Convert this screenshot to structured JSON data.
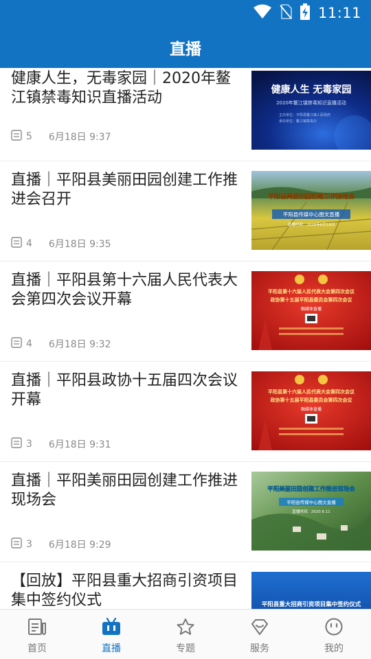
{
  "status": {
    "time": "11:11"
  },
  "header": {
    "title": "直播"
  },
  "items": [
    {
      "title": "健康人生，无毒家园｜2020年鳌江镇禁毒知识直播活动",
      "count": "5",
      "time": "6月18日 9:37",
      "thumb": {
        "headline": "健康人生 无毒家园",
        "sub": "2020年鳌江镇禁毒知识直播活动",
        "note1": "主办单位：平阳县鳌江镇人民政府",
        "note2": "承办单位：鳌江镇禁毒办"
      }
    },
    {
      "title": "直播｜平阳县美丽田园创建工作推进会召开",
      "count": "4",
      "time": "6月18日 9:35",
      "thumb": {
        "headline": "平阳县美丽田园创建工作推进会",
        "sub": "平阳县传媒中心图文直播",
        "note1": "直播时间：2020年6月18日"
      }
    },
    {
      "title": "直播｜平阳县第十六届人民代表大会第四次会议开幕",
      "count": "4",
      "time": "6月18日 9:32",
      "thumb": {
        "line1": "平阳县第十六届人民代表大会第四次会议",
        "line2": "政协第十五届平阳县委员会第四次会议",
        "badge": "融媒体直播"
      }
    },
    {
      "title": "直播｜平阳县政协十五届四次会议开幕",
      "count": "3",
      "time": "6月18日 9:31",
      "thumb": {
        "line1": "平阳县第十六届人民代表大会第四次会议",
        "line2": "政协第十五届平阳县委员会第四次会议",
        "badge": "融媒体直播"
      }
    },
    {
      "title": "直播｜平阳美丽田园创建工作推进现场会",
      "count": "3",
      "time": "6月18日 9:29",
      "thumb": {
        "headline": "平阳美丽田园创建工作推进现场会",
        "sub": "平阳县传媒中心图文直播",
        "note1": "直播时间：2020.6.11"
      }
    },
    {
      "title": "【回放】平阳县重大招商引资项目集中签约仪式",
      "count": "",
      "time": "",
      "thumb": {
        "headline": "平阳县重大招商引资项目集中签约仪式"
      }
    }
  ],
  "tabs": [
    {
      "label": "首页",
      "icon": "news-icon",
      "active": false
    },
    {
      "label": "直播",
      "icon": "tv-icon",
      "active": true
    },
    {
      "label": "专题",
      "icon": "star-icon",
      "active": false
    },
    {
      "label": "服务",
      "icon": "service-icon",
      "active": false
    },
    {
      "label": "我的",
      "icon": "profile-icon",
      "active": false
    }
  ],
  "colors": {
    "primary": "#1273c2",
    "text": "#222222",
    "meta": "#8a8a8a"
  }
}
